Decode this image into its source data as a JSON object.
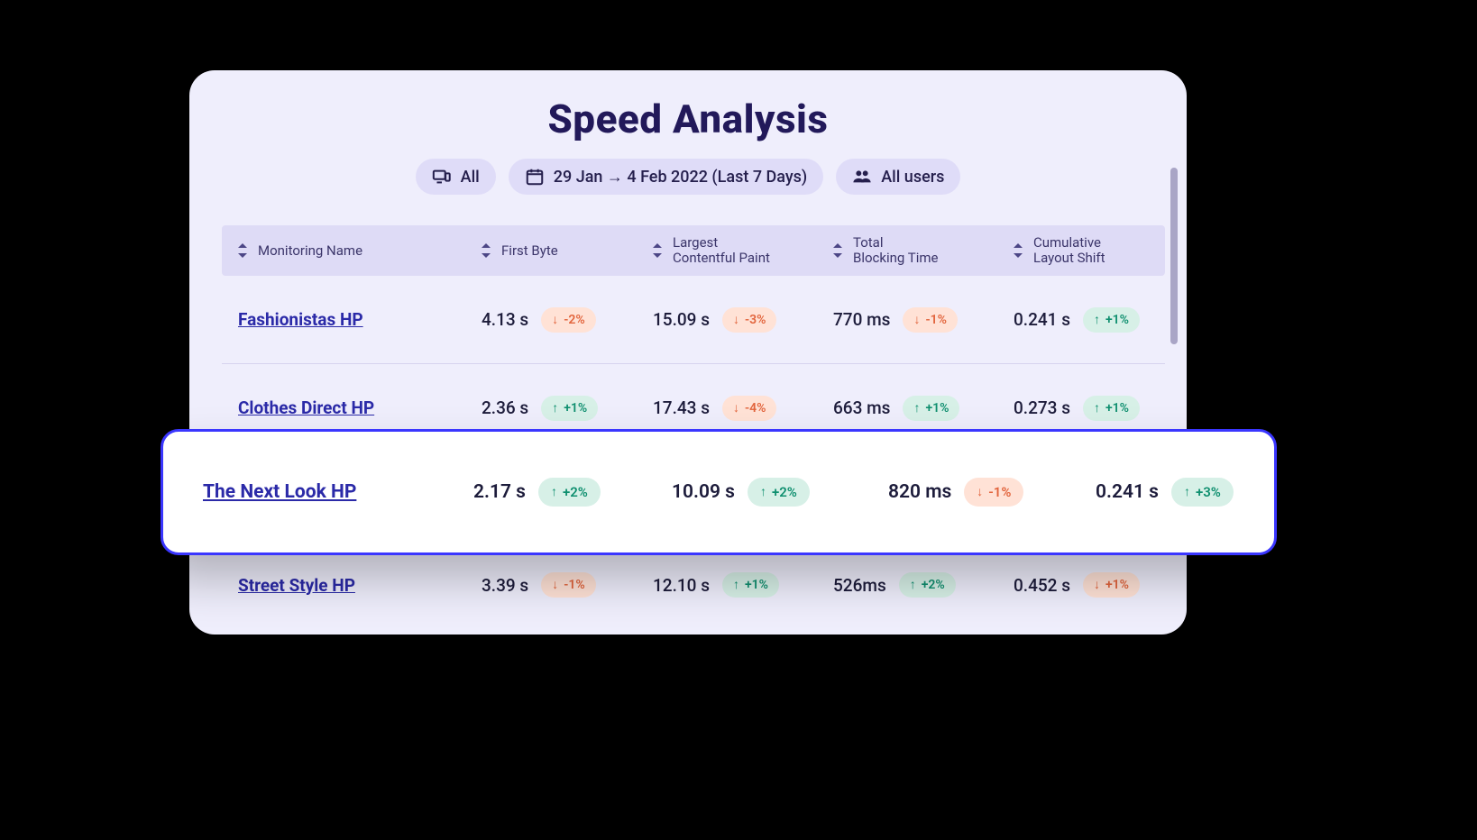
{
  "title": "Speed Analysis",
  "filters": {
    "device": "All",
    "date_range": "29 Jan → 4 Feb 2022 (Last 7 Days)",
    "users": "All users"
  },
  "columns": {
    "c0": "Monitoring Name",
    "c1": "First Byte",
    "c2a": "Largest",
    "c2b": "Contentful Paint",
    "c3a": "Total",
    "c3b": "Blocking Time",
    "c4a": "Cumulative",
    "c4b": "Layout Shift"
  },
  "rows": [
    {
      "name": "Fashionistas HP",
      "first_byte": {
        "value": "4.13 s",
        "dir": "down",
        "delta": "-2%"
      },
      "lcp": {
        "value": "15.09 s",
        "dir": "down",
        "delta": "-3%"
      },
      "tbt": {
        "value": "770 ms",
        "dir": "down",
        "delta": "-1%"
      },
      "cls": {
        "value": "0.241 s",
        "dir": "up",
        "delta": "+1%"
      }
    },
    {
      "name": "Clothes Direct HP",
      "first_byte": {
        "value": "2.36 s",
        "dir": "up",
        "delta": "+1%"
      },
      "lcp": {
        "value": "17.43 s",
        "dir": "down",
        "delta": "-4%"
      },
      "tbt": {
        "value": "663 ms",
        "dir": "up",
        "delta": "+1%"
      },
      "cls": {
        "value": "0.273 s",
        "dir": "up",
        "delta": "+1%"
      }
    },
    {
      "name": "The Next Look HP",
      "first_byte": {
        "value": "2.17 s",
        "dir": "up",
        "delta": "+2%"
      },
      "lcp": {
        "value": "10.09 s",
        "dir": "up",
        "delta": "+2%"
      },
      "tbt": {
        "value": "820 ms",
        "dir": "down",
        "delta": "-1%"
      },
      "cls": {
        "value": "0.241 s",
        "dir": "up",
        "delta": "+3%"
      }
    },
    {
      "name": "Street Style HP",
      "first_byte": {
        "value": "3.39 s",
        "dir": "down",
        "delta": "-1%"
      },
      "lcp": {
        "value": "12.10 s",
        "dir": "up",
        "delta": "+1%"
      },
      "tbt": {
        "value": "526ms",
        "dir": "up",
        "delta": "+2%"
      },
      "cls": {
        "value": "0.452 s",
        "dir": "down",
        "delta": "+1%"
      }
    }
  ],
  "highlight_index": 2
}
